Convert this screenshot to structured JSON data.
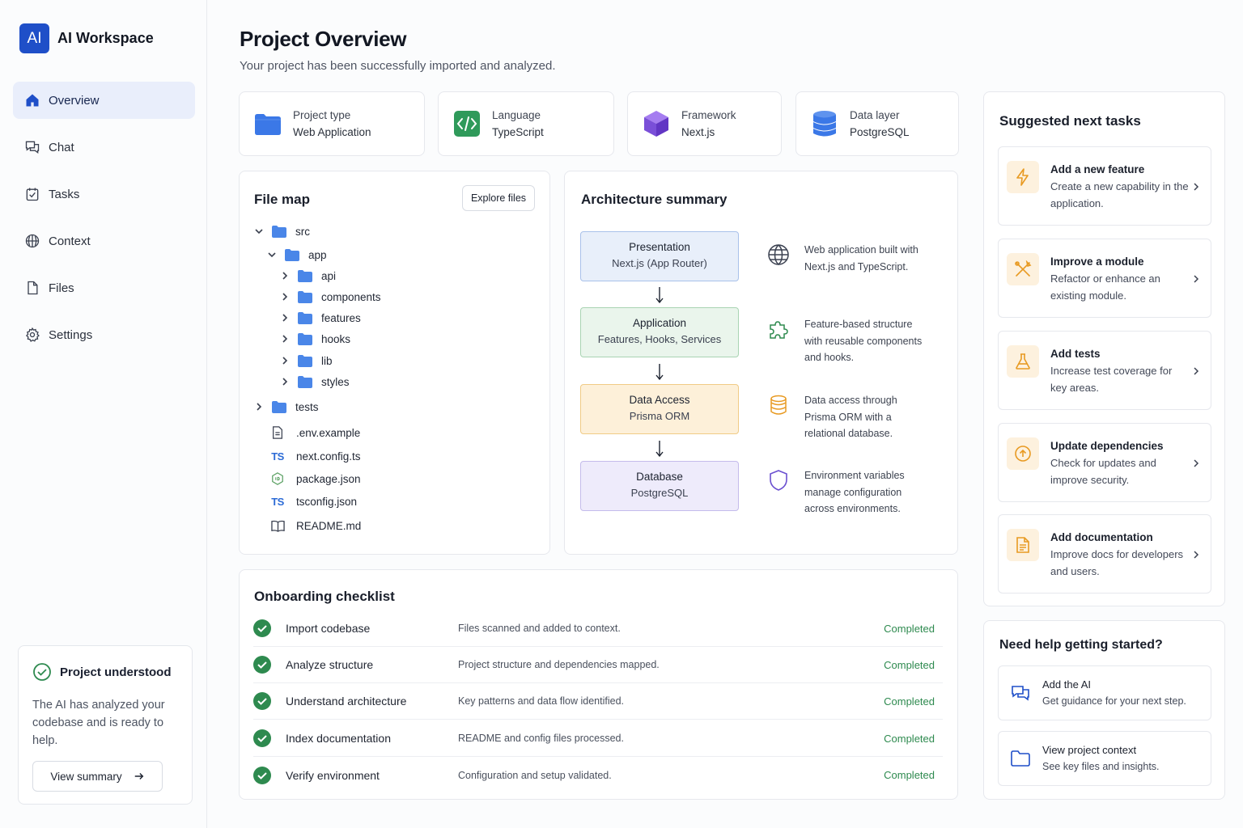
{
  "brand": {
    "logo": "AI",
    "name": "AI Workspace"
  },
  "nav": [
    {
      "label": "Overview",
      "icon": "home-icon",
      "active": true
    },
    {
      "label": "Chat",
      "icon": "chat-icon"
    },
    {
      "label": "Tasks",
      "icon": "tasks-icon"
    },
    {
      "label": "Context",
      "icon": "context-icon"
    },
    {
      "label": "Files",
      "icon": "file-icon"
    },
    {
      "label": "Settings",
      "icon": "gear-icon"
    }
  ],
  "status_card": {
    "title": "Project understood",
    "text": "The AI has analyzed your codebase and is ready to help.",
    "button": "View summary"
  },
  "header": {
    "title": "Project Overview",
    "subtitle": "Your project has been successfully imported and analyzed."
  },
  "info_cards": [
    {
      "label": "Project type",
      "value": "Web Application",
      "icon": "folder-icon"
    },
    {
      "label": "Language",
      "value": "TypeScript",
      "icon": "code-icon"
    },
    {
      "label": "Framework",
      "value": "Next.js",
      "icon": "cube-icon"
    },
    {
      "label": "Data layer",
      "value": "PostgreSQL",
      "icon": "database-icon"
    }
  ],
  "file_map": {
    "title": "File map",
    "button": "Explore files",
    "items": [
      {
        "name": "src",
        "kind": "folder",
        "expanded": true
      },
      {
        "name": "app",
        "kind": "folder",
        "expanded": true
      },
      {
        "name": "api",
        "kind": "folder"
      },
      {
        "name": "components",
        "kind": "folder"
      },
      {
        "name": "features",
        "kind": "folder"
      },
      {
        "name": "hooks",
        "kind": "folder"
      },
      {
        "name": "lib",
        "kind": "folder"
      },
      {
        "name": "styles",
        "kind": "folder"
      },
      {
        "name": "tests",
        "kind": "folder"
      },
      {
        "name": ".env.example",
        "kind": "file",
        "icon": "document-icon"
      },
      {
        "name": "next.config.ts",
        "kind": "file",
        "icon": "ts-icon",
        "badge": "TS"
      },
      {
        "name": "package.json",
        "kind": "file",
        "icon": "node-icon"
      },
      {
        "name": "tsconfig.json",
        "kind": "file",
        "icon": "ts-icon",
        "badge": "TS"
      },
      {
        "name": "README.md",
        "kind": "file",
        "icon": "book-icon"
      }
    ]
  },
  "architecture": {
    "title": "Architecture summary",
    "layers": [
      {
        "name": "Presentation",
        "sub": "Next.js (App Router)",
        "bg": "#e8effa",
        "border": "#a9c1ea"
      },
      {
        "name": "Application",
        "sub": "Features, Hooks, Services",
        "bg": "#eaf5ec",
        "border": "#a9d4b3"
      },
      {
        "name": "Data Access",
        "sub": "Prisma ORM",
        "bg": "#fdf0d9",
        "border": "#f0cb86"
      },
      {
        "name": "Database",
        "sub": "PostgreSQL",
        "bg": "#eeebfb",
        "border": "#c4bbeb"
      }
    ],
    "descriptions": [
      {
        "text": "Web application built with Next.js and TypeScript.",
        "icon": "globe-icon"
      },
      {
        "text": "Feature-based structure with reusable components and hooks.",
        "icon": "puzzle-icon"
      },
      {
        "text": "Data access through Prisma ORM with a relational database.",
        "icon": "database-icon"
      },
      {
        "text": "Environment variables manage configuration across environments.",
        "icon": "shield-icon"
      }
    ]
  },
  "checklist": {
    "title": "Onboarding checklist",
    "items": [
      {
        "name": "Import codebase",
        "desc": "Files scanned and added to context.",
        "status": "Completed"
      },
      {
        "name": "Analyze structure",
        "desc": "Project structure and dependencies mapped.",
        "status": "Completed"
      },
      {
        "name": "Understand architecture",
        "desc": "Key patterns and data flow identified.",
        "status": "Completed"
      },
      {
        "name": "Index documentation",
        "desc": "README and config files processed.",
        "status": "Completed"
      },
      {
        "name": "Verify environment",
        "desc": "Configuration and setup validated.",
        "status": "Completed"
      }
    ]
  },
  "suggested": {
    "title": "Suggested next tasks",
    "items": [
      {
        "title": "Add a new feature",
        "desc": "Create a new capability in the application.",
        "icon": "lightning-icon"
      },
      {
        "title": "Improve a module",
        "desc": "Refactor or enhance an existing module.",
        "icon": "tools-icon"
      },
      {
        "title": "Add tests",
        "desc": "Increase test coverage for key areas.",
        "icon": "flask-icon"
      },
      {
        "title": "Update dependencies",
        "desc": "Check for updates and improve security.",
        "icon": "upload-icon"
      },
      {
        "title": "Add documentation",
        "desc": "Improve docs for developers and users.",
        "icon": "document-icon"
      }
    ]
  },
  "help": {
    "title": "Need help getting started?",
    "items": [
      {
        "title": "Add the AI",
        "desc": "Get guidance for your next step.",
        "icon": "chat-icon"
      },
      {
        "title": "View project context",
        "desc": "See key files and insights.",
        "icon": "folder-icon"
      }
    ]
  },
  "colors": {
    "accent": "#1f4fc8",
    "success": "#2e8a4f",
    "folder": "#4a86e8",
    "task_icon_bg": "#fdf1de",
    "task_icon": "#e89a22"
  }
}
